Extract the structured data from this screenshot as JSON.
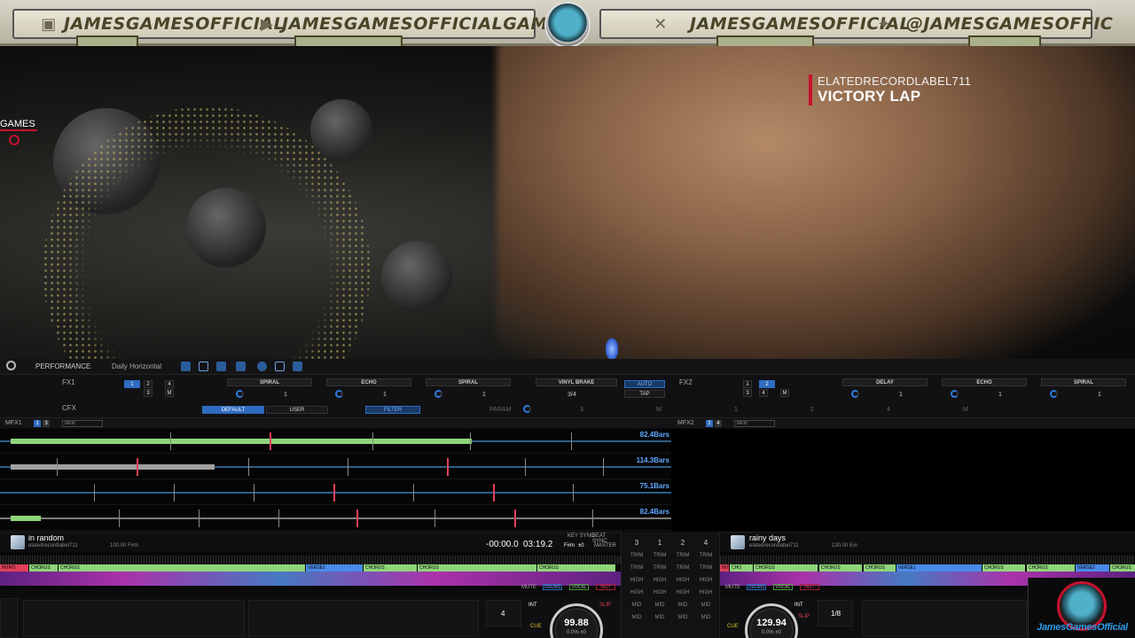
{
  "banner": {
    "twitch_handle": "JAMESGAMESOFFICIAL",
    "youtube_handle": "JAMESGAMESOFFICIALGAME",
    "x_handle": "JAMESGAMESOFFICIAL",
    "twitter_handle": "@JAMESGAMESOFFIC",
    "icons": [
      "twitch-icon",
      "youtube-icon",
      "x-icon",
      "twitter-bird-icon"
    ]
  },
  "overlay": {
    "now_playing_artist": "ELATEDRECORDLABEL711",
    "now_playing_title": "VICTORY LAP",
    "games_label": "GAMES",
    "accent_color": "#c8102e"
  },
  "toolbar": {
    "mode": "PERFORMANCE",
    "library": "Daily Horizontal"
  },
  "fx": {
    "fx1_label": "FX1",
    "fx2_label": "FX2",
    "cfx_label": "CFX",
    "fx1_slots": [
      "SPIRAL",
      "ECHO",
      "SPIRAL"
    ],
    "fx2_slots": [
      "DELAY",
      "ECHO",
      "SPIRAL"
    ],
    "beat_values": [
      "1",
      "1",
      "1"
    ],
    "beat_values_r": [
      "1",
      "1",
      "1"
    ],
    "vinyl_brake": "VINYL BRAKE",
    "vinyl_value": "3/4",
    "auto": "AUTO",
    "tap": "TAP",
    "cfx_default": "DEFAULT",
    "cfx_user": "USER",
    "cfx_filter": "FILTER",
    "cfx_param": "PARAM",
    "fx1_beats": [
      "1",
      "2",
      "3",
      "4",
      "M"
    ],
    "fx2_beats": [
      "1",
      "2",
      "3",
      "4",
      "M"
    ],
    "cfx_nums": [
      "1",
      "2",
      "3",
      "4",
      "M"
    ]
  },
  "mfx": {
    "mfx1": "MFX1",
    "mfx2": "MFX2",
    "mfx1_badges": [
      "1",
      "3"
    ],
    "mfx2_badges": [
      "2",
      "4"
    ],
    "mem": "MEM"
  },
  "tracks": [
    {
      "bars": "82.4Bars"
    },
    {
      "bars": "114.3Bars"
    },
    {
      "bars": "75.1Bars"
    },
    {
      "bars": "82.4Bars"
    }
  ],
  "deck1": {
    "title": "in random",
    "artist": "elatedrecordlabel711",
    "bpm_key": "100.00 F#m",
    "time_elapsed": "-00:00.0",
    "time_total": "03:19.2",
    "key": "F#m",
    "key_offset": "±0",
    "key_sync": "KEY SYNC",
    "beat_sync": "BEAT SYNC",
    "master": "MASTER",
    "jog_bpm": "99.88",
    "jog_pct": "0.0%",
    "jog_offset": "±0",
    "quantize": "4",
    "int": "INT",
    "slip": "SLIP",
    "cue": "CUE",
    "sections": [
      "INTRO",
      "CHORUS",
      "CHORUS",
      "VERSE1",
      "CHORUS",
      "CHORUS",
      "CHORUS"
    ]
  },
  "deck2": {
    "title": "rainy days",
    "artist": "elatedrecordlabel711",
    "bpm_key": "130.00 Em",
    "jog_bpm": "129.94",
    "jog_pct": "0.0%",
    "jog_offset": "±0",
    "quantize": "1/8",
    "int": "INT",
    "slip": "SLIP",
    "cue": "CUE",
    "sections": [
      "INTRO",
      "CHO",
      "CHORUS",
      "CHORUS",
      "CHORUS",
      "VERSE1",
      "CHORUS",
      "CHORUS",
      "VERSE2",
      "CHORUS"
    ]
  },
  "mixer": {
    "channels": [
      "3",
      "1",
      "2",
      "4"
    ],
    "rows": [
      "TRIM",
      "TRIM",
      "HIGH",
      "HIGH",
      "MID",
      "MID"
    ],
    "mute": "MUTE",
    "drums": "DRUMS",
    "vocal": "VOCAL",
    "inst": "INST"
  },
  "cam": {
    "name": "JamesGamesOfficial"
  }
}
